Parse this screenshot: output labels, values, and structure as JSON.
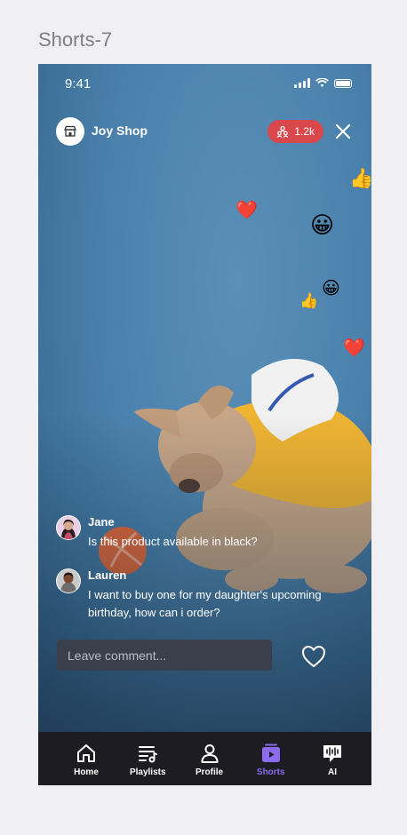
{
  "frame": {
    "title": "Shorts-7"
  },
  "status_bar": {
    "time": "9:41"
  },
  "header": {
    "shop_name": "Joy Shop",
    "viewer_count": "1.2k",
    "badge_color": "#d9484c"
  },
  "reactions": [
    "thumbs-up-emoji",
    "heart-emoji",
    "grinning-face-emoji",
    "thumbs-up-emoji",
    "grinning-face-emoji",
    "heart-emoji"
  ],
  "comments": [
    {
      "name": "Jane",
      "text": "Is this product available in black?"
    },
    {
      "name": "Lauren",
      "text": "I want to buy one for my daughter's upcoming birthday, how can i order?"
    }
  ],
  "comment_input": {
    "placeholder": "Leave comment..."
  },
  "tabbar": {
    "active_color": "#8b6cf0",
    "items": [
      {
        "label": "Home",
        "icon": "home-icon"
      },
      {
        "label": "Playlists",
        "icon": "playlist-icon"
      },
      {
        "label": "Profile",
        "icon": "profile-icon"
      },
      {
        "label": "Shorts",
        "icon": "shorts-icon",
        "active": true
      },
      {
        "label": "AI",
        "icon": "ai-chat-icon"
      }
    ]
  }
}
